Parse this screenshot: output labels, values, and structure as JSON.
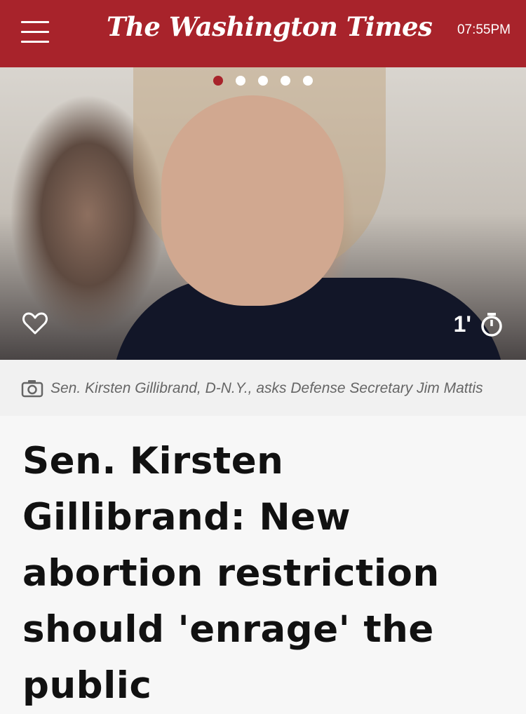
{
  "header": {
    "logo": "The Washington Times",
    "time": "07:55PM",
    "brand_color": "#a8232b"
  },
  "carousel": {
    "dot_count": 5,
    "active_index": 0
  },
  "hero": {
    "read_time": "1'",
    "icons": [
      "heart-icon",
      "stopwatch-icon"
    ]
  },
  "caption": {
    "text": "Sen. Kirsten Gillibrand, D-N.Y., asks Defense Secretary Jim Mattis",
    "icon": "camera-icon"
  },
  "article": {
    "headline": "Sen. Kirsten Gillibrand: New abortion restriction should 'enrage' the public"
  }
}
